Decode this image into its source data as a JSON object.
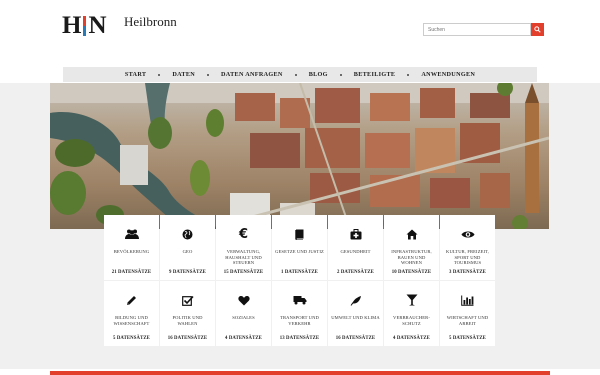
{
  "logo": {
    "mark_h": "H",
    "mark_n": "N",
    "site_name": "Heilbronn",
    "colors": {
      "bar_top": "#e2402d",
      "bar_bottom": "#2a7ab8"
    }
  },
  "search": {
    "placeholder": "Suchen",
    "icon": "search-icon",
    "accent": "#e2402d"
  },
  "nav": {
    "items": [
      "START",
      "DATEN",
      "DATEN ANFRAGEN",
      "BLOG",
      "BETEILIGTE",
      "ANWENDUNGEN"
    ]
  },
  "hero": {
    "description_icon": "city-aerial-photo"
  },
  "categories": [
    {
      "icon": "people-icon",
      "label": "BEVÖLKERUNG",
      "count": "21 DATENSÄTZE"
    },
    {
      "icon": "globe-icon",
      "label": "GEO",
      "count": "9 DATENSÄTZE"
    },
    {
      "icon": "euro-icon",
      "label": "VERWALTUNG, HAUSHALT UND STEUERN",
      "count": "15 DATENSÄTZE"
    },
    {
      "icon": "book-icon",
      "label": "GESETZE UND JUSTIZ",
      "count": "1 DATENSÄTZE"
    },
    {
      "icon": "medkit-icon",
      "label": "GESUNDHEIT",
      "count": "2 DATENSÄTZE"
    },
    {
      "icon": "home-icon",
      "label": "INFRASTRUKTUR, BAUEN UND WOHNEN",
      "count": "10 DATENSÄTZE"
    },
    {
      "icon": "eye-icon",
      "label": "KULTUR, FREIZEIT, SPORT UND TOURISMUS",
      "count": "3 DATENSÄTZE"
    },
    {
      "icon": "pencil-icon",
      "label": "BILDUNG UND WISSENSCHAFT",
      "count": "5 DATENSÄTZE"
    },
    {
      "icon": "checkbox-icon",
      "label": "POLITIK UND WAHLEN",
      "count": "16 DATENSÄTZE"
    },
    {
      "icon": "heart-icon",
      "label": "SOZIALES",
      "count": "4 DATENSÄTZE"
    },
    {
      "icon": "truck-icon",
      "label": "TRANSPORT UND VERKEHR",
      "count": "13 DATENSÄTZE"
    },
    {
      "icon": "leaf-icon",
      "label": "UMWELT UND KLIMA",
      "count": "16 DATENSÄTZE"
    },
    {
      "icon": "glass-icon",
      "label": "VERBRAUCHER-SCHUTZ",
      "count": "4 DATENSÄTZE"
    },
    {
      "icon": "bar-chart-icon",
      "label": "WIRTSCHAFT UND ARBEIT",
      "count": "5 DATENSÄTZE"
    }
  ],
  "colors": {
    "accent": "#e2402d",
    "nav_bg": "#e8e8e8",
    "band_bg": "#f0f0f0"
  }
}
